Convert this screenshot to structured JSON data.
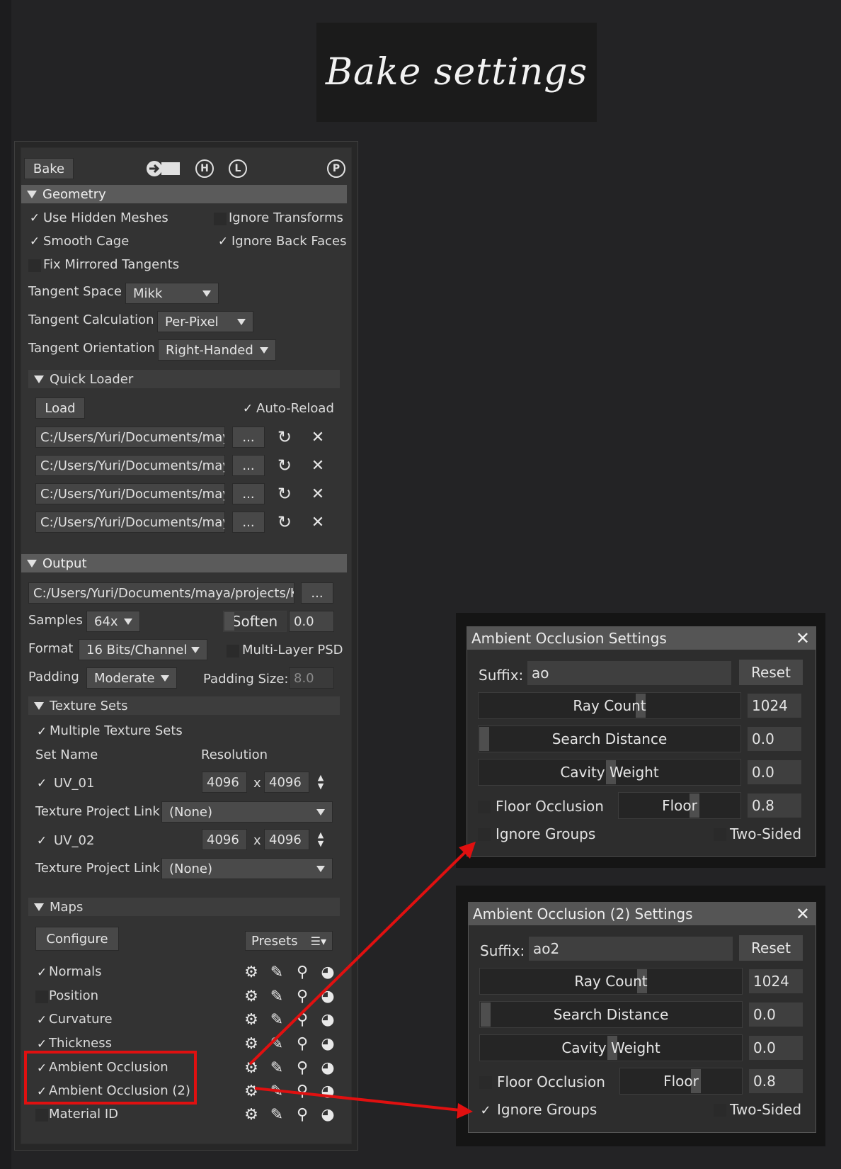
{
  "title": "Bake settings",
  "toolbar": {
    "bake": "Bake",
    "icon_h": "H",
    "icon_l": "L",
    "icon_p": "P"
  },
  "geometry": {
    "header": "Geometry",
    "use_hidden_meshes": "Use Hidden Meshes",
    "ignore_transforms": "Ignore Transforms",
    "smooth_cage": "Smooth Cage",
    "ignore_back_faces": "Ignore Back Faces",
    "fix_mirrored": "Fix Mirrored Tangents",
    "tangent_space_label": "Tangent Space",
    "tangent_space_value": "Mikk",
    "tangent_calc_label": "Tangent Calculation",
    "tangent_calc_value": "Per-Pixel",
    "tangent_orient_label": "Tangent Orientation",
    "tangent_orient_value": "Right-Handed"
  },
  "quick_loader": {
    "header": "Quick Loader",
    "load": "Load",
    "auto_reload": "Auto-Reload",
    "browse": "...",
    "paths": [
      "C:/Users/Yuri/Documents/maya",
      "C:/Users/Yuri/Documents/maya",
      "C:/Users/Yuri/Documents/maya",
      "C:/Users/Yuri/Documents/maya"
    ]
  },
  "output": {
    "header": "Output",
    "path": "C:/Users/Yuri/Documents/maya/projects/Kni",
    "browse": "...",
    "samples_label": "Samples",
    "samples_value": "64x",
    "soften_label": "Soften",
    "soften_value": "0.0",
    "format_label": "Format",
    "format_value": "16 Bits/Channel",
    "multilayer": "Multi-Layer PSD",
    "padding_label": "Padding",
    "padding_value": "Moderate",
    "padding_size_label": "Padding Size:",
    "padding_size_value": "8.0"
  },
  "texture_sets": {
    "header": "Texture Sets",
    "multiple": "Multiple Texture Sets",
    "col_set_name": "Set Name",
    "col_resolution": "Resolution",
    "x": "x",
    "link_label": "Texture Project Link",
    "sets": [
      {
        "name": "UV_01",
        "w": "4096",
        "h": "4096",
        "link": "(None)"
      },
      {
        "name": "UV_02",
        "w": "4096",
        "h": "4096",
        "link": "(None)"
      }
    ]
  },
  "maps": {
    "header": "Maps",
    "configure": "Configure",
    "presets": "Presets",
    "items": [
      {
        "label": "Normals",
        "checked": true
      },
      {
        "label": "Position",
        "checked": false
      },
      {
        "label": "Curvature",
        "checked": true
      },
      {
        "label": "Thickness",
        "checked": true
      },
      {
        "label": "Ambient Occlusion",
        "checked": true
      },
      {
        "label": "Ambient Occlusion (2)",
        "checked": true
      },
      {
        "label": "Material ID",
        "checked": false
      }
    ]
  },
  "ao1": {
    "title": "Ambient Occlusion Settings",
    "suffix_label": "Suffix:",
    "suffix_value": "ao",
    "reset": "Reset",
    "ray_count_label": "Ray Count",
    "ray_count_value": "1024",
    "search_distance_label": "Search Distance",
    "search_distance_value": "0.0",
    "cavity_weight_label": "Cavity Weight",
    "cavity_weight_value": "0.0",
    "floor_occlusion": "Floor Occlusion",
    "floor_label": "Floor",
    "floor_value": "0.8",
    "ignore_groups": "Ignore Groups",
    "two_sided": "Two-Sided"
  },
  "ao2": {
    "title": "Ambient Occlusion (2) Settings",
    "suffix_label": "Suffix:",
    "suffix_value": "ao2",
    "reset": "Reset",
    "ray_count_label": "Ray Count",
    "ray_count_value": "1024",
    "search_distance_label": "Search Distance",
    "search_distance_value": "0.0",
    "cavity_weight_label": "Cavity Weight",
    "cavity_weight_value": "0.0",
    "floor_occlusion": "Floor Occlusion",
    "floor_label": "Floor",
    "floor_value": "0.8",
    "ignore_groups": "Ignore Groups",
    "two_sided": "Two-Sided"
  },
  "colors": {
    "accent_red": "#e01010",
    "section_bar": "#5b5b5b",
    "panel": "#333333"
  }
}
